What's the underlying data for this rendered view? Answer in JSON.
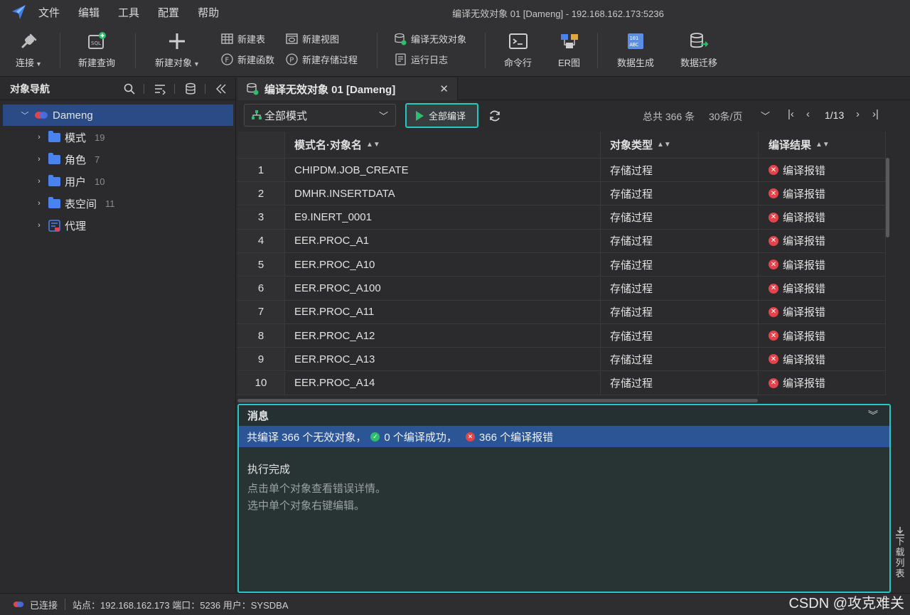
{
  "menubar": {
    "items": [
      "文件",
      "编辑",
      "工具",
      "配置",
      "帮助"
    ],
    "window_title": "编译无效对象 01 [Dameng]  - 192.168.162.173:5236"
  },
  "toolbar": {
    "connect": "连接",
    "new_query": "新建查询",
    "new_object": "新建对象",
    "new_table": "新建表",
    "new_view": "新建视图",
    "new_function": "新建函数",
    "new_procedure": "新建存储过程",
    "compile_invalid": "编译无效对象",
    "run_log": "运行日志",
    "command_line": "命令行",
    "er_diagram": "ER图",
    "data_generation": "数据生成",
    "data_migration": "数据迁移"
  },
  "nav": {
    "title": "对象导航",
    "root": "Dameng",
    "items": [
      {
        "label": "模式",
        "count": "19"
      },
      {
        "label": "角色",
        "count": "7"
      },
      {
        "label": "用户",
        "count": "10"
      },
      {
        "label": "表空间",
        "count": "11"
      },
      {
        "label": "代理",
        "count": ""
      }
    ]
  },
  "tab": {
    "label": "编译无效对象 01 [Dameng]"
  },
  "actions": {
    "schema_select": "全部模式",
    "compile_all": "全部编译",
    "total": "总共 366 条",
    "page_size": "30条/页",
    "page": "1/13"
  },
  "grid": {
    "columns": [
      "模式名·对象名",
      "对象类型",
      "编译结果"
    ],
    "rows": [
      {
        "n": "1",
        "name": "CHIPDM.JOB_CREATE",
        "type": "存储过程",
        "result": "编译报错"
      },
      {
        "n": "2",
        "name": "DMHR.INSERTDATA",
        "type": "存储过程",
        "result": "编译报错"
      },
      {
        "n": "3",
        "name": "E9.INERT_0001",
        "type": "存储过程",
        "result": "编译报错"
      },
      {
        "n": "4",
        "name": "EER.PROC_A1",
        "type": "存储过程",
        "result": "编译报错"
      },
      {
        "n": "5",
        "name": "EER.PROC_A10",
        "type": "存储过程",
        "result": "编译报错"
      },
      {
        "n": "6",
        "name": "EER.PROC_A100",
        "type": "存储过程",
        "result": "编译报错"
      },
      {
        "n": "7",
        "name": "EER.PROC_A11",
        "type": "存储过程",
        "result": "编译报错"
      },
      {
        "n": "8",
        "name": "EER.PROC_A12",
        "type": "存储过程",
        "result": "编译报错"
      },
      {
        "n": "9",
        "name": "EER.PROC_A13",
        "type": "存储过程",
        "result": "编译报错"
      },
      {
        "n": "10",
        "name": "EER.PROC_A14",
        "type": "存储过程",
        "result": "编译报错"
      }
    ]
  },
  "messages": {
    "title": "消息",
    "summary_prefix": "共编译 366 个无效对象，",
    "summary_success": "0 个编译成功，",
    "summary_error": "366 个编译报错",
    "done": "执行完成",
    "hint1": "点击单个对象查看错误详情。",
    "hint2": "选中单个对象右键编辑。"
  },
  "download": [
    "下",
    "载",
    "列",
    "表"
  ],
  "status": {
    "connected": "已连接",
    "info": "站点：192.168.162.173  端口：5236  用户：SYSDBA"
  },
  "watermark": "CSDN @攻克难关",
  "colors": {
    "accent": "#28c7c2",
    "selection": "#2a4b85",
    "error": "#e5434b",
    "success": "#2ebd6d"
  }
}
